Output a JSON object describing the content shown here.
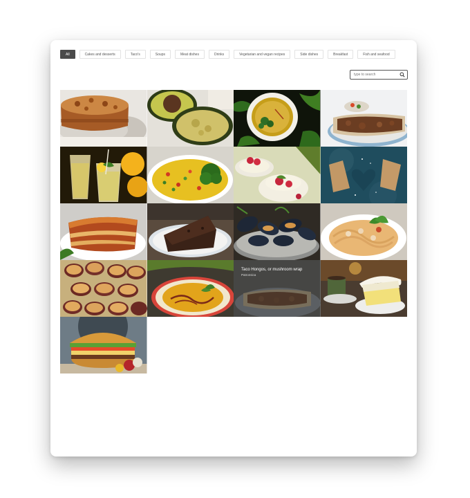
{
  "filters": [
    {
      "label": "All",
      "active": true
    },
    {
      "label": "Cakes and desserts"
    },
    {
      "label": "Taco's"
    },
    {
      "label": "Soups"
    },
    {
      "label": "Meat dishes"
    },
    {
      "label": "Drinks"
    },
    {
      "label": "Vegetarian and vegan recipes"
    },
    {
      "label": "Side dishes"
    },
    {
      "label": "Breakfast"
    },
    {
      "label": "Fish and seafood"
    }
  ],
  "search": {
    "placeholder": "type to search"
  },
  "gallery": {
    "hover_item": {
      "title": "Taco Hongos, or mushroom wrap",
      "category": "Patronsica"
    }
  }
}
